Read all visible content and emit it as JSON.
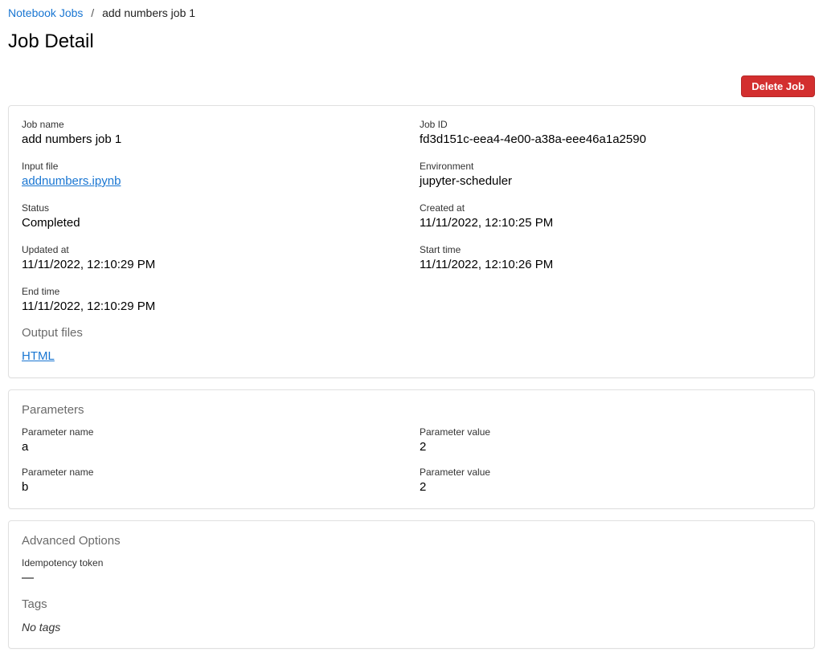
{
  "breadcrumb": {
    "root": "Notebook Jobs",
    "current": "add numbers job 1"
  },
  "page_title": "Job Detail",
  "actions": {
    "delete_label": "Delete Job"
  },
  "details": {
    "job_name": {
      "label": "Job name",
      "value": "add numbers job 1"
    },
    "job_id": {
      "label": "Job ID",
      "value": "fd3d151c-eea4-4e00-a38a-eee46a1a2590"
    },
    "input_file": {
      "label": "Input file",
      "value": "addnumbers.ipynb"
    },
    "environment": {
      "label": "Environment",
      "value": "jupyter-scheduler"
    },
    "status": {
      "label": "Status",
      "value": "Completed"
    },
    "created_at": {
      "label": "Created at",
      "value": "11/11/2022, 12:10:25 PM"
    },
    "updated_at": {
      "label": "Updated at",
      "value": "11/11/2022, 12:10:29 PM"
    },
    "start_time": {
      "label": "Start time",
      "value": "11/11/2022, 12:10:26 PM"
    },
    "end_time": {
      "label": "End time",
      "value": "11/11/2022, 12:10:29 PM"
    }
  },
  "output_files": {
    "heading": "Output files",
    "items": [
      {
        "label": "HTML"
      }
    ]
  },
  "parameters": {
    "heading": "Parameters",
    "name_label": "Parameter name",
    "value_label": "Parameter value",
    "rows": [
      {
        "name": "a",
        "value": "2"
      },
      {
        "name": "b",
        "value": "2"
      }
    ]
  },
  "advanced": {
    "heading": "Advanced Options",
    "idempotency": {
      "label": "Idempotency token",
      "value": "—"
    },
    "tags_heading": "Tags",
    "no_tags": "No tags"
  }
}
